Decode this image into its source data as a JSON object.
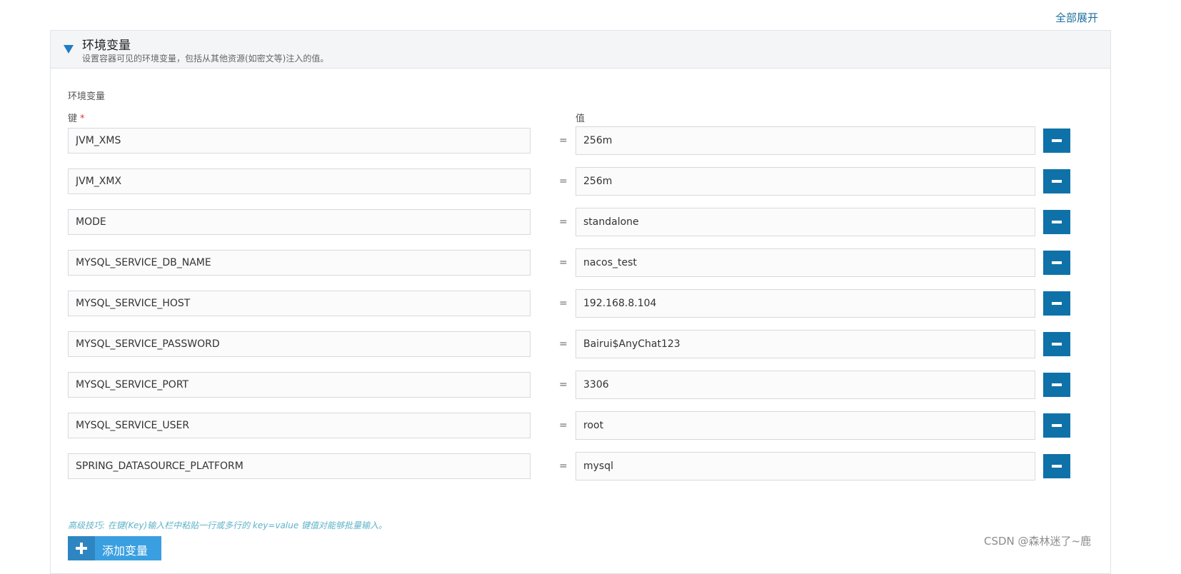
{
  "header": {
    "expand_all": "全部展开"
  },
  "section": {
    "title": "环境变量",
    "description": "设置容器可见的环境变量，包括从其他资源(如密文等)注入的值。",
    "group_label": "环境变量",
    "key_column_label": "键",
    "required_mark": "*",
    "value_column_label": "值",
    "separator": "=",
    "rows": [
      {
        "key": "JVM_XMS",
        "value": "256m"
      },
      {
        "key": "JVM_XMX",
        "value": "256m"
      },
      {
        "key": "MODE",
        "value": "standalone"
      },
      {
        "key": "MYSQL_SERVICE_DB_NAME",
        "value": "nacos_test"
      },
      {
        "key": "MYSQL_SERVICE_HOST",
        "value": "192.168.8.104"
      },
      {
        "key": "MYSQL_SERVICE_PASSWORD",
        "value": "Bairui$AnyChat123"
      },
      {
        "key": "MYSQL_SERVICE_PORT",
        "value": "3306"
      },
      {
        "key": "MYSQL_SERVICE_USER",
        "value": "root"
      },
      {
        "key": "SPRING_DATASOURCE_PLATFORM",
        "value": "mysql"
      }
    ],
    "tip": "高级技巧: 在键(Key)输入栏中粘贴一行或多行的 key=value 键值对能够批量输入。",
    "add_button_label": "添加变量"
  },
  "watermark": "CSDN @森林迷了~鹿",
  "colors": {
    "accent": "#0e72a9",
    "add_button": "#3a9fe0",
    "link": "#1f6f9f",
    "required": "#d9383a",
    "tip": "#5fb3c9"
  },
  "icons": {
    "toggle": "triangle-down-icon",
    "remove": "minus-icon",
    "add": "plus-icon"
  }
}
